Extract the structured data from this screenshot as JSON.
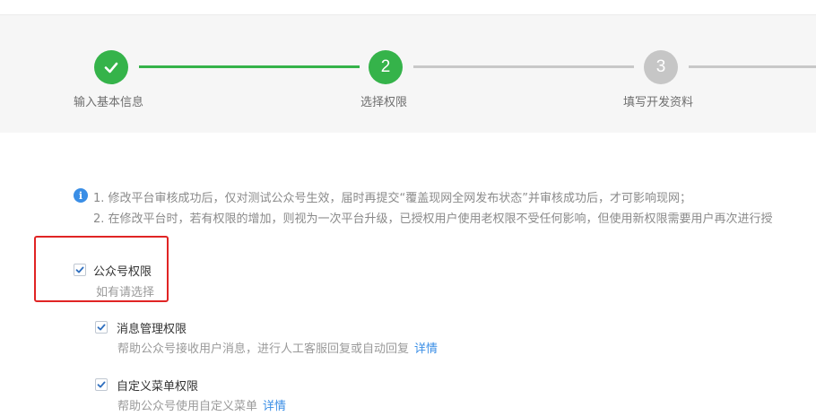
{
  "steps": [
    {
      "number": "",
      "label": "输入基本信息",
      "state": "done"
    },
    {
      "number": "2",
      "label": "选择权限",
      "state": "active"
    },
    {
      "number": "3",
      "label": "填写开发资料",
      "state": "todo"
    }
  ],
  "notice": {
    "icon": "i",
    "line1": "1. 修改平台审核成功后，仅对测试公众号生效，届时再提交“覆盖现网全网发布状态”并审核成功后，才可影响现网；",
    "line2": "2. 在修改平台时，若有权限的增加，则视为一次平台升级，已授权用户使用老权限不受任何影响，但使用新权限需要用户再次进行授"
  },
  "permissions": {
    "group": {
      "title": "公众号权限",
      "subtitle": "如有请选择",
      "checked": true
    },
    "items": [
      {
        "title": "消息管理权限",
        "desc": "帮助公众号接收用户消息，进行人工客服回复或自动回复",
        "link": "详情",
        "checked": true
      },
      {
        "title": "自定义菜单权限",
        "desc": "帮助公众号使用自定义菜单",
        "link": "详情",
        "checked": true
      }
    ]
  },
  "colors": {
    "accent_green": "#35b34a",
    "link_blue": "#3a8ee6",
    "highlight_red": "#e02424"
  }
}
